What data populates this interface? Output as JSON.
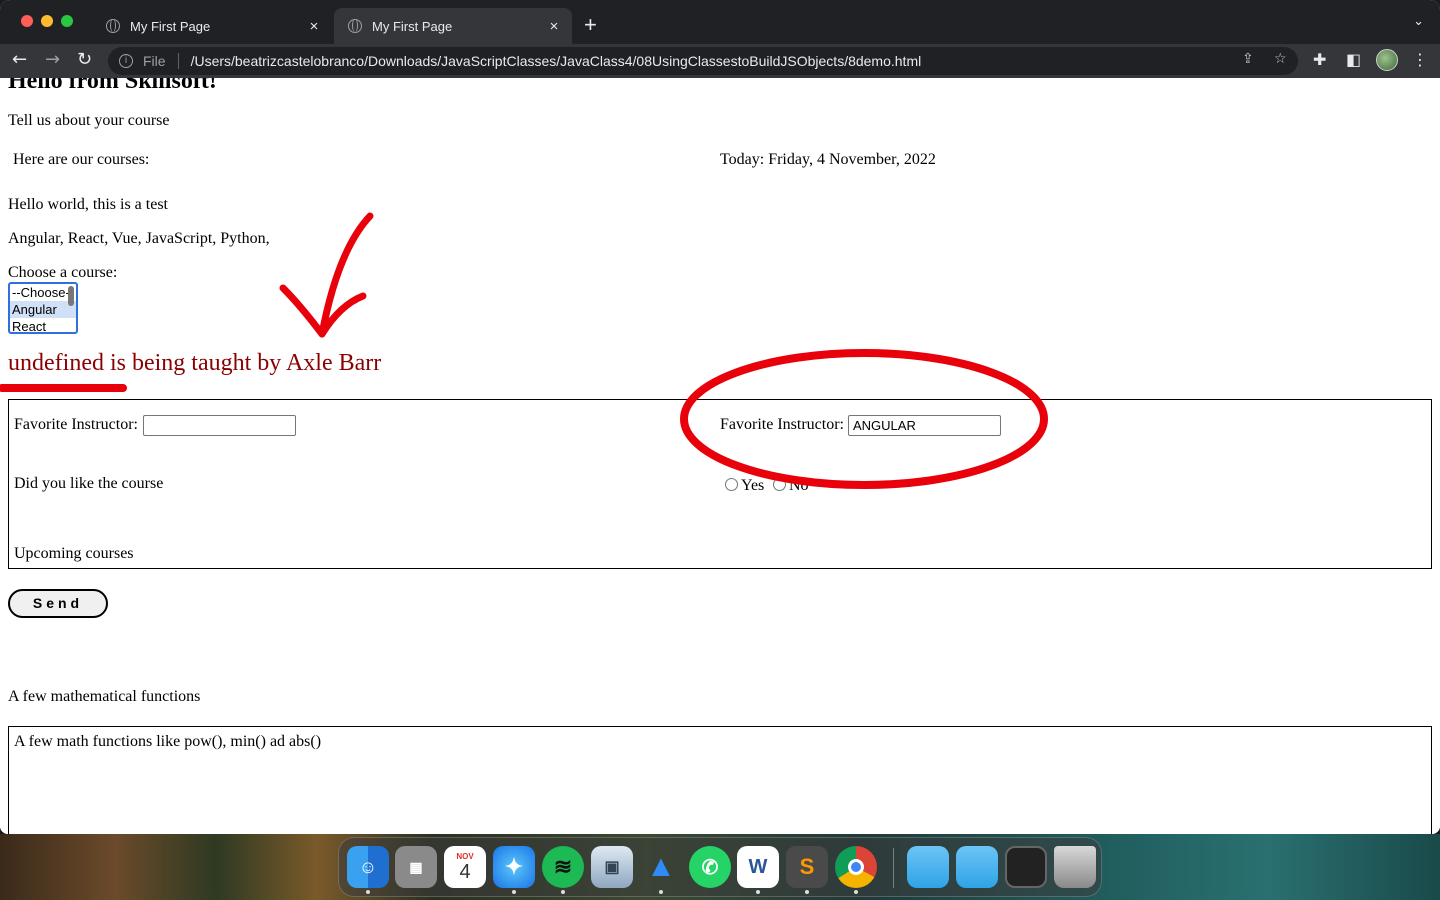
{
  "browser": {
    "tabs": [
      {
        "title": "My First Page",
        "close": "×"
      },
      {
        "title": "My First Page",
        "close": "×"
      }
    ],
    "new_tab": "+",
    "tab_menu": "⌄",
    "nav": {
      "back": "←",
      "forward": "→",
      "reload": "↻"
    },
    "address": {
      "scheme": "File",
      "url": "/Users/beatrizcastelobranco/Downloads/JavaScriptClasses/JavaClass4/08UsingClassestoBuildJSObjects/8demo.html"
    }
  },
  "page": {
    "heading": "Hello from Skillsoft!",
    "intro": "Tell us about your course",
    "courses_label": "Here are our courses:",
    "today": "Today: Friday, 4 November, 2022",
    "hello_line": "Hello world, this is a test",
    "course_list": "Angular, React, Vue, JavaScript, Python,",
    "choose_label": "Choose a course:",
    "select_options": [
      "--Choose--",
      "Angular",
      "React"
    ],
    "selected_option": "Angular",
    "taught_line": "undefined is being taught by Axle Barr",
    "form": {
      "fav_instructor_label_left": "Favorite Instructor:",
      "fav_instructor_value_left": "",
      "fav_instructor_label_right": "Favorite Instructor:",
      "fav_instructor_value_right": "ANGULAR",
      "liked_label": "Did you like the course",
      "radio_yes": "Yes",
      "radio_no": "No",
      "upcoming_label": "Upcoming courses"
    },
    "send_label": "Send",
    "math_heading": "A few mathematical functions",
    "math_box_text": "A few math functions like pow(), min() ad abs()"
  },
  "annotation_color": "#e8000b",
  "dock": {
    "apps": [
      {
        "name": "Finder",
        "icon": "finder-icon",
        "running": true
      },
      {
        "name": "Launchpad",
        "icon": "launchpad-icon",
        "running": false
      },
      {
        "name": "Calendar",
        "icon": "calendar-icon",
        "running": false,
        "month": "NOV",
        "day": "4"
      },
      {
        "name": "Safari",
        "icon": "safari-icon",
        "running": true
      },
      {
        "name": "Spotify",
        "icon": "spotify-icon",
        "running": true
      },
      {
        "name": "Preview",
        "icon": "preview-icon",
        "running": false
      },
      {
        "name": "Spark",
        "icon": "spark-icon",
        "running": true
      },
      {
        "name": "WhatsApp",
        "icon": "whatsapp-icon",
        "running": false
      },
      {
        "name": "Word",
        "icon": "word-icon",
        "running": true
      },
      {
        "name": "Sublime Text",
        "icon": "sublime-icon",
        "running": true
      },
      {
        "name": "Chrome",
        "icon": "chrome-icon",
        "running": true
      },
      {
        "name": "Folder",
        "icon": "folder-icon",
        "running": false
      },
      {
        "name": "Downloads",
        "icon": "downloads-folder-icon",
        "running": false
      },
      {
        "name": "Screenshot",
        "icon": "screenshot-icon",
        "running": false
      },
      {
        "name": "Trash",
        "icon": "trash-icon",
        "running": false
      }
    ]
  }
}
